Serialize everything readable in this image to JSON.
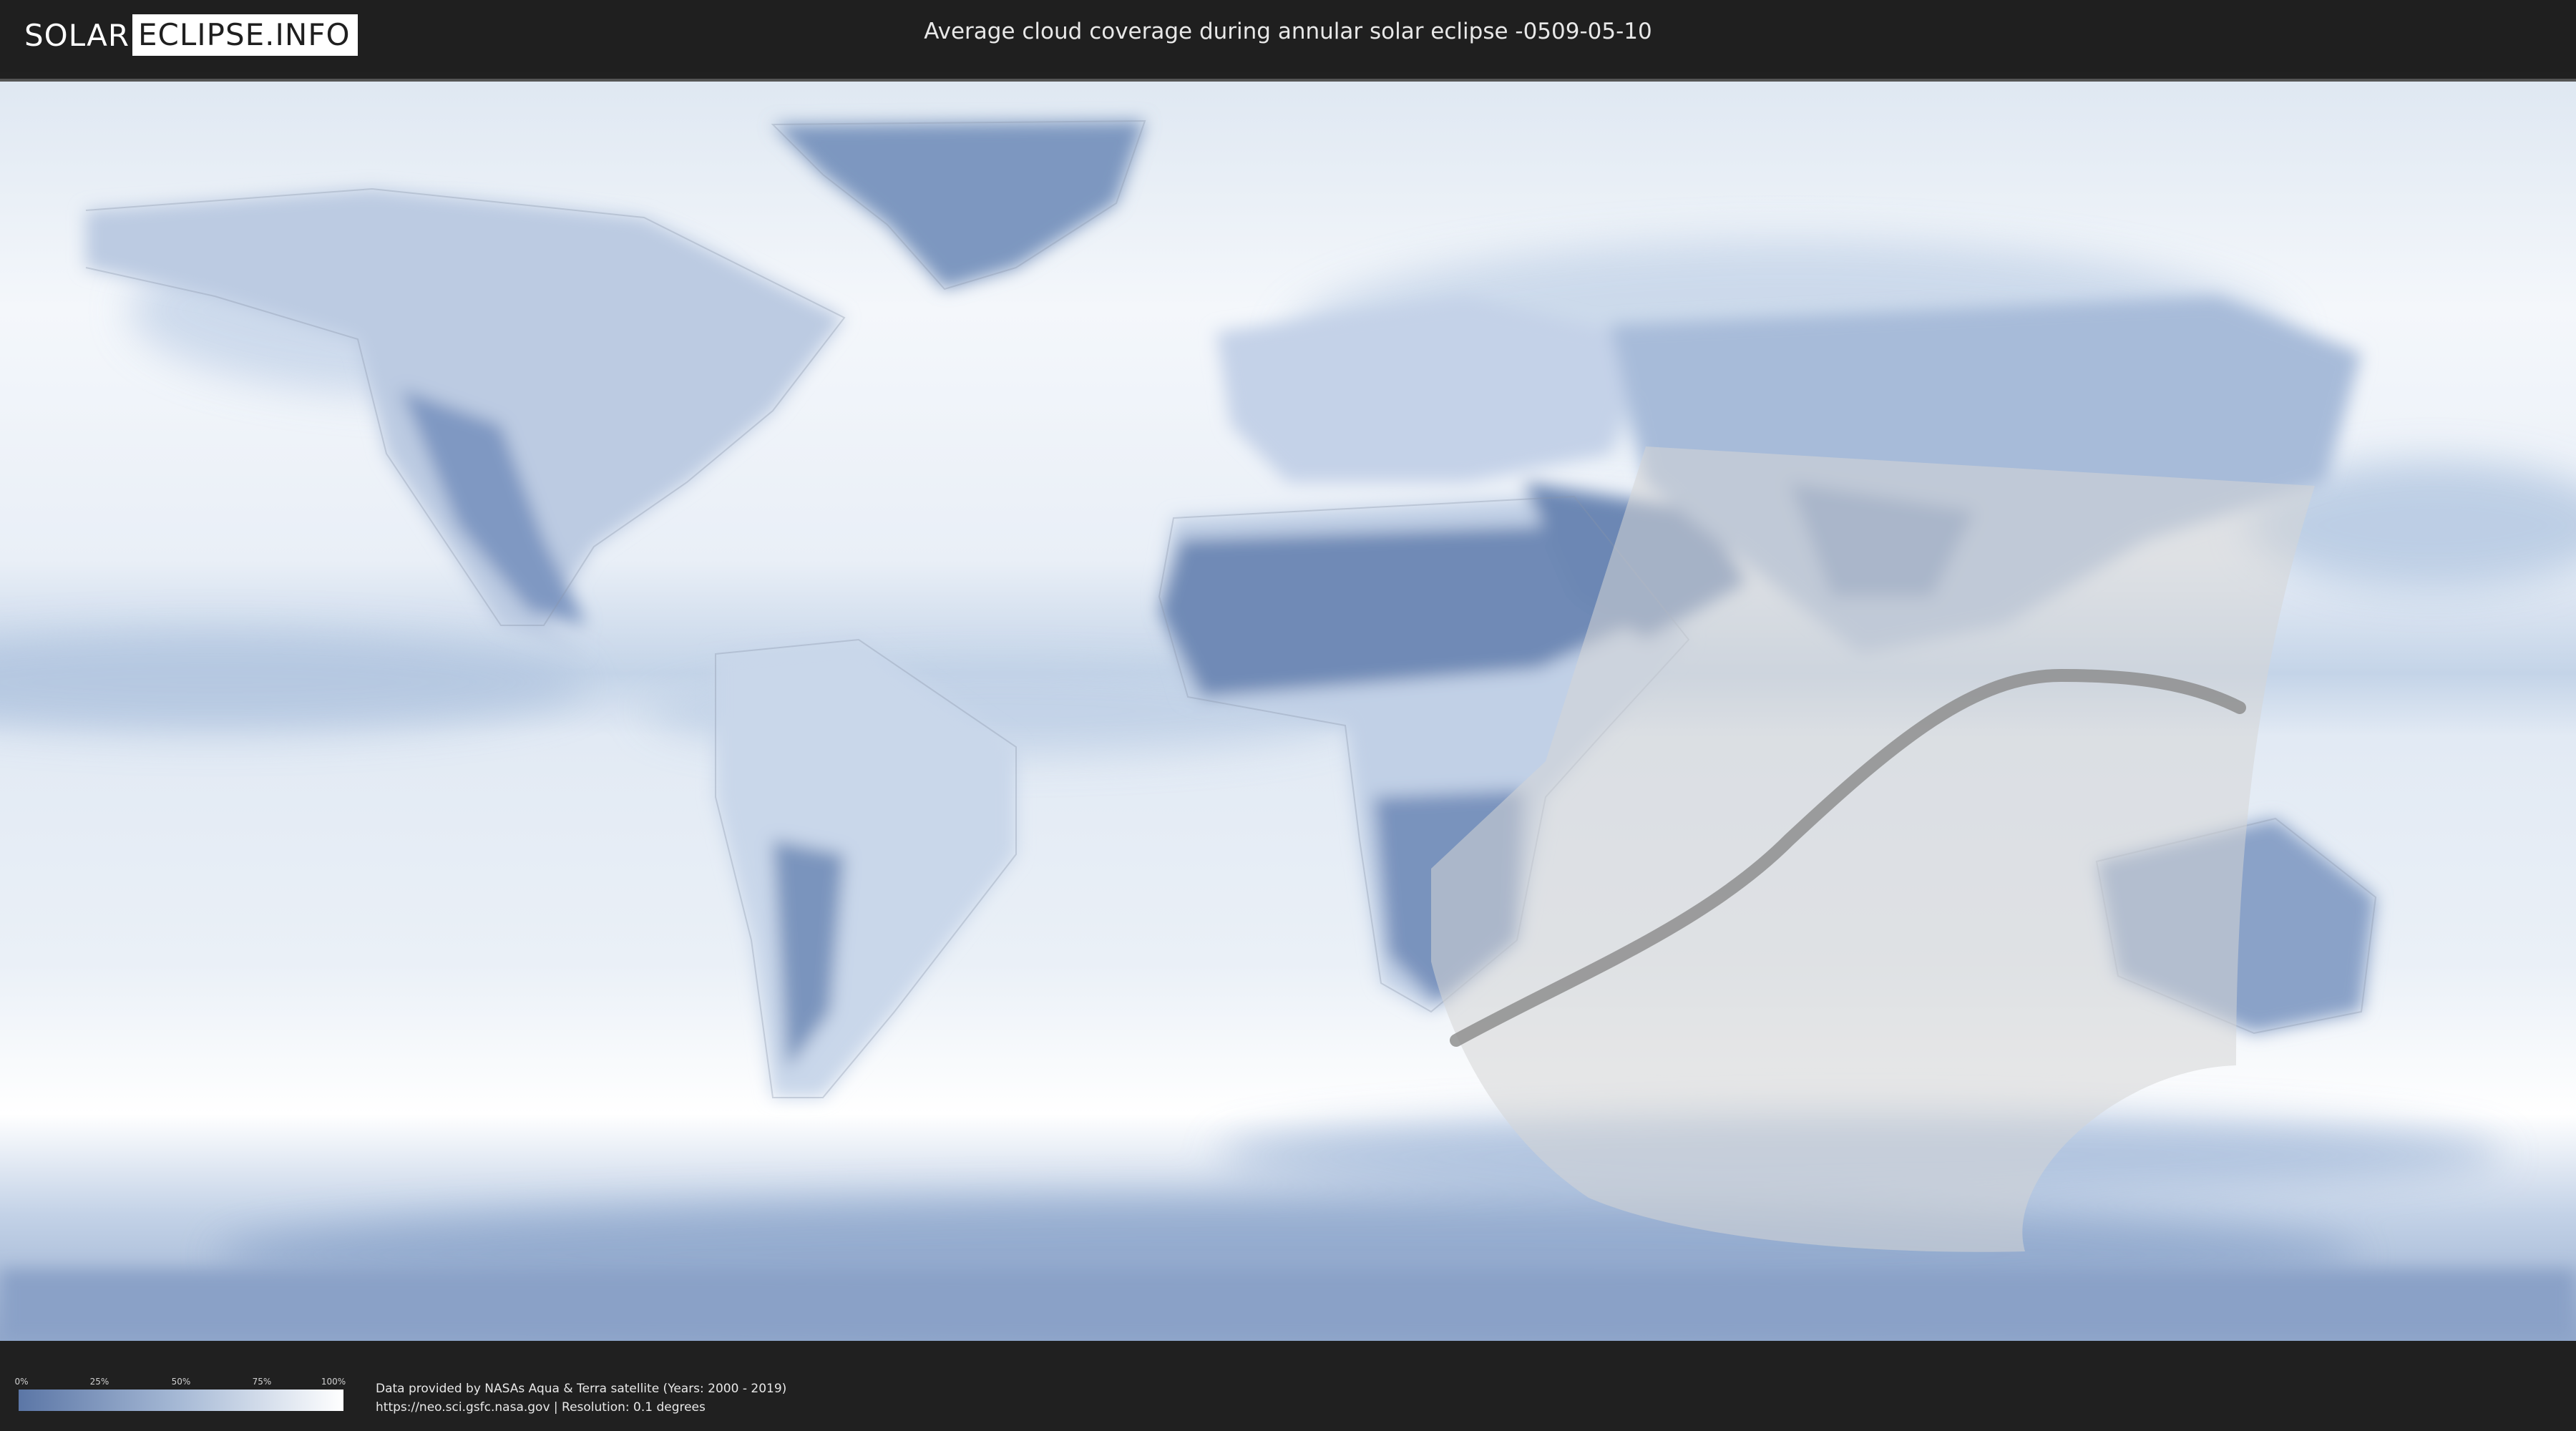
{
  "header": {
    "logo_part1": "SOLAR",
    "logo_part2": "ECLIPSE.INFO",
    "title": "Average cloud coverage during annular solar eclipse -0509-05-10"
  },
  "legend": {
    "ticks": [
      "0%",
      "25%",
      "50%",
      "75%",
      "100%"
    ],
    "colors": {
      "low": "#5b76a6",
      "mid": "#a7bad6",
      "high": "#ffffff"
    }
  },
  "footer": {
    "credit_line1": "Data provided by NASAs Aqua & Terra satellite (Years: 2000 - 2019)",
    "credit_line2": "https://neo.sci.gsfc.nasa.gov | Resolution: 0.1 degrees"
  },
  "map": {
    "projection": "equirectangular",
    "ocean_color": "#eef3f8",
    "cloud_color": "#b9cbe2",
    "land_cloud_color": "#7a94bd",
    "eclipse_visibility_color": "#d6d6d6",
    "central_path_color": "#8a8a8a"
  }
}
